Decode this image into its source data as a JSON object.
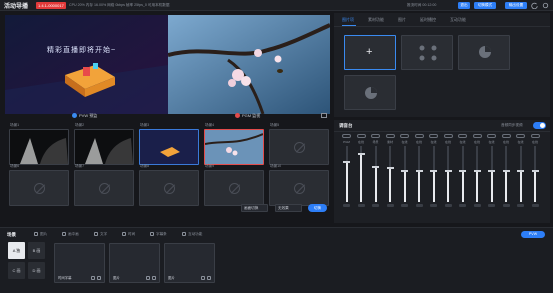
{
  "app": {
    "title": "活动导播",
    "badge": "1.4.1-0000017",
    "stats": "CPU 20%  内存 16.00%  网络 0kbps  帧率 25fps_0  可用本机数据",
    "timer_label": "推流时间",
    "timer": "00:12:00"
  },
  "topbar": {
    "btn1": "退出",
    "btn2": "切换模式",
    "btn3": "输出设置",
    "btn_colors": [
      "#2d7ef7",
      "#2d7ef7",
      "#2d7ef7"
    ]
  },
  "preview": {
    "pvw_label": "PVW 预监",
    "pgm_label": "PGM 监视",
    "pvw_text": "精彩直播即将开始~"
  },
  "scenes": [
    {
      "name": "场景1",
      "state": "normal",
      "thumb": "dark"
    },
    {
      "name": "场景2",
      "state": "normal",
      "thumb": "dark"
    },
    {
      "name": "场景3",
      "state": "pvw",
      "thumb": "promo"
    },
    {
      "name": "场景4",
      "state": "active",
      "thumb": "flower"
    },
    {
      "name": "场景5",
      "state": "empty"
    },
    {
      "name": "场景6",
      "state": "empty"
    },
    {
      "name": "场景7",
      "state": "empty"
    },
    {
      "name": "场景8",
      "state": "empty"
    },
    {
      "name": "场景9",
      "state": "empty"
    },
    {
      "name": "场景10",
      "state": "empty"
    }
  ],
  "scene_controls": {
    "select1": "画面切换",
    "select2": "无效果",
    "cut_button": "切换"
  },
  "right_tabs": [
    {
      "label": "图片项",
      "active": true
    },
    {
      "label": "素材功能",
      "active": false
    },
    {
      "label": "图片",
      "active": false
    },
    {
      "label": "延时播控",
      "active": false
    },
    {
      "label": "互动功能",
      "active": false
    }
  ],
  "mixer": {
    "title": "调音台",
    "mute_label": "音频同步视频",
    "toggle_on": true,
    "channels": [
      {
        "label": "PGM",
        "level": 0.72
      },
      {
        "label": "在线",
        "level": 0.85
      },
      {
        "label": "场景",
        "level": 0.62
      },
      {
        "label": "素材",
        "level": 0.6
      },
      {
        "label": "在线",
        "level": 0.55
      },
      {
        "label": "在线",
        "level": 0.55
      },
      {
        "label": "在线",
        "level": 0.55
      },
      {
        "label": "在线",
        "level": 0.55
      },
      {
        "label": "在线",
        "level": 0.55
      },
      {
        "label": "在线",
        "level": 0.55
      },
      {
        "label": "在线",
        "level": 0.55
      },
      {
        "label": "在线",
        "level": 0.55
      },
      {
        "label": "在线",
        "level": 0.55
      },
      {
        "label": "在线",
        "level": 0.55
      }
    ]
  },
  "bottom": {
    "title": "场景",
    "tabs": [
      "图片",
      "画中画",
      "文字",
      "时间",
      "字幕条",
      "互动功能"
    ],
    "pvw_btn": "PVW",
    "layouts": [
      "A 独",
      "B 画",
      "C 画",
      "D 画"
    ],
    "cards": [
      {
        "label": "时间字幕",
        "tag": "编辑"
      },
      {
        "label": "图片",
        "tag": "编辑"
      },
      {
        "label": "图片",
        "tag": ""
      }
    ]
  }
}
